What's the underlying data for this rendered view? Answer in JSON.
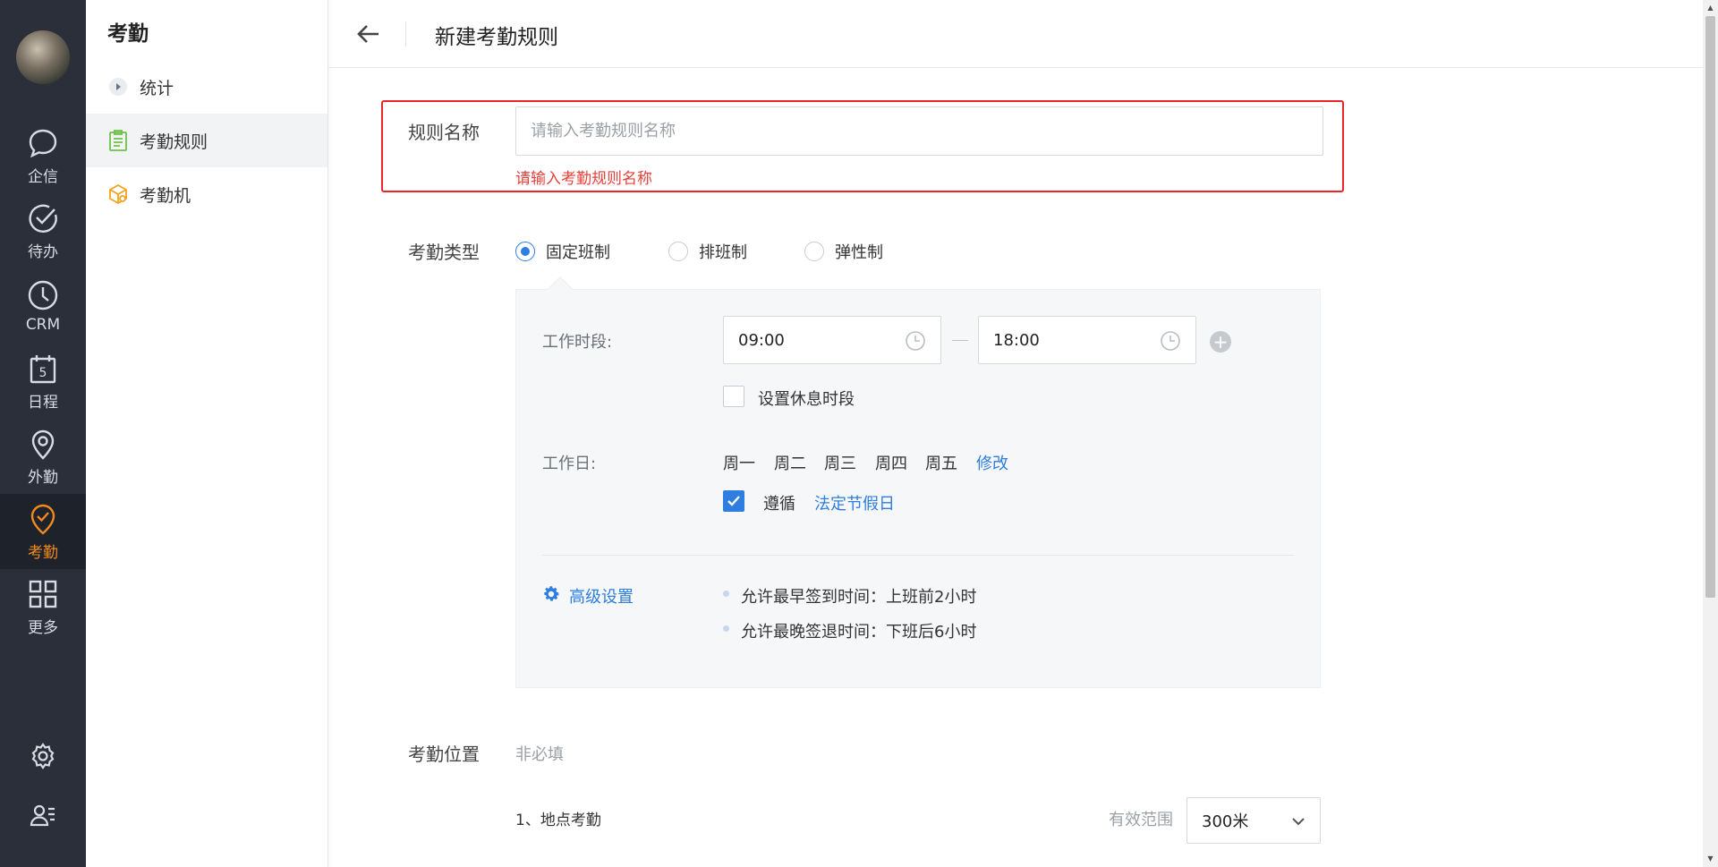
{
  "rail": {
    "items": [
      {
        "label": "企信",
        "icon": "chat-bubble-icon"
      },
      {
        "label": "待办",
        "icon": "check-circle-icon"
      },
      {
        "label": "CRM",
        "icon": "clock-icon"
      },
      {
        "label": "日程",
        "icon": "calendar-icon",
        "day": "5"
      },
      {
        "label": "外勤",
        "icon": "map-pin-icon"
      },
      {
        "label": "考勤",
        "icon": "attendance-pin-icon",
        "active": true
      },
      {
        "label": "更多",
        "icon": "grid-icon"
      }
    ]
  },
  "sidebar": {
    "title": "考勤",
    "items": [
      {
        "label": "统计",
        "icon": "play-circle-icon"
      },
      {
        "label": "考勤规则",
        "icon": "clipboard-icon",
        "active": true
      },
      {
        "label": "考勤机",
        "icon": "device-box-icon"
      }
    ]
  },
  "header": {
    "title": "新建考勤规则"
  },
  "form": {
    "rule_name_label": "规则名称",
    "rule_name_placeholder": "请输入考勤规则名称",
    "rule_name_error": "请输入考勤规则名称",
    "type_label": "考勤类型",
    "types": [
      {
        "label": "固定班制",
        "selected": true
      },
      {
        "label": "排班制",
        "selected": false
      },
      {
        "label": "弹性制",
        "selected": false
      }
    ],
    "work_period_label": "工作时段:",
    "start_time": "09:00",
    "end_time": "18:00",
    "rest_period_label": "设置休息时段",
    "workday_label": "工作日:",
    "workdays": [
      "周一",
      "周二",
      "周三",
      "周四",
      "周五"
    ],
    "modify_link": "修改",
    "follow_label": "遵循",
    "holiday_link": "法定节假日",
    "advanced_label": "高级设置",
    "advanced_items": [
      "允许最早签到时间：上班前2小时",
      "允许最晚签退时间：下班后6小时"
    ],
    "location_label": "考勤位置",
    "location_hint": "非必填",
    "location_item": "1、地点考勤",
    "range_label": "有效范围",
    "range_value": "300米"
  },
  "colors": {
    "accent": "#2e7de1",
    "active_rail": "#f08a1d",
    "error": "#e8262a",
    "rail_bg": "#2a2f3a"
  }
}
